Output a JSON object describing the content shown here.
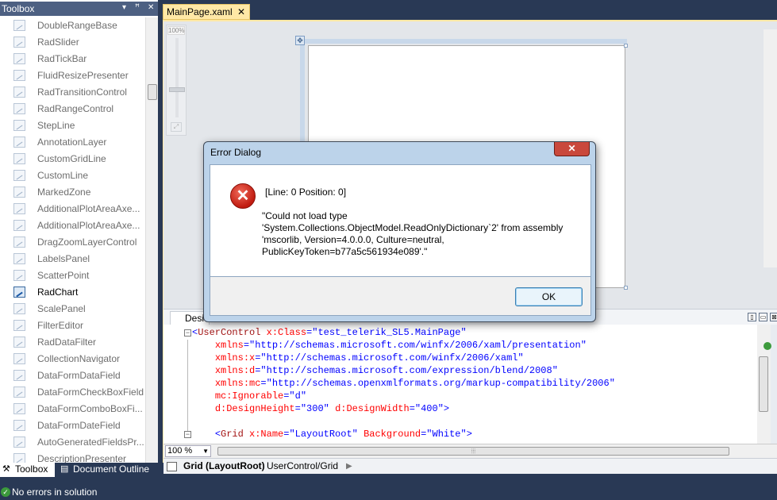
{
  "toolbox": {
    "title": "Toolbox",
    "pin_label": "▾",
    "pin_icon_label": "ꟸ",
    "close_label": "✕",
    "items": [
      {
        "label": "DoubleRangeBase"
      },
      {
        "label": "RadSlider"
      },
      {
        "label": "RadTickBar"
      },
      {
        "label": "FluidResizePresenter"
      },
      {
        "label": "RadTransitionControl"
      },
      {
        "label": "RadRangeControl"
      },
      {
        "label": "StepLine"
      },
      {
        "label": "AnnotationLayer"
      },
      {
        "label": "CustomGridLine"
      },
      {
        "label": "CustomLine"
      },
      {
        "label": "MarkedZone"
      },
      {
        "label": "AdditionalPlotAreaAxe..."
      },
      {
        "label": "AdditionalPlotAreaAxe..."
      },
      {
        "label": "DragZoomLayerControl"
      },
      {
        "label": "LabelsPanel"
      },
      {
        "label": "ScatterPoint"
      },
      {
        "label": "RadChart"
      },
      {
        "label": "ScalePanel"
      },
      {
        "label": "FilterEditor"
      },
      {
        "label": "RadDataFilter"
      },
      {
        "label": "CollectionNavigator"
      },
      {
        "label": "DataFormDataField"
      },
      {
        "label": "DataFormCheckBoxField"
      },
      {
        "label": "DataFormComboBoxFi..."
      },
      {
        "label": "DataFormDateField"
      },
      {
        "label": "AutoGeneratedFieldsPr..."
      },
      {
        "label": "DescriptionPresenter"
      }
    ]
  },
  "bottom_tabs": {
    "toolbox": "Toolbox",
    "document_outline": "Document Outline"
  },
  "status": {
    "text": "No errors in solution"
  },
  "document": {
    "tab_label": "MainPage.xaml",
    "tab_close": "✕"
  },
  "designer": {
    "zoom_slider_label": "100%",
    "design_tab_label": "Desi"
  },
  "editor": {
    "zoom_value": "100 %"
  },
  "breadcrumb": {
    "current": "Grid (LayoutRoot)",
    "path": "UserControl/Grid"
  },
  "dialog": {
    "title": "Error Dialog",
    "close_label": "✕",
    "line1": "[Line: 0 Position: 0]",
    "message_lines": [
      "\"Could not load type",
      "'System.Collections.ObjectModel.ReadOnlyDictionary`2' from assembly",
      "'mscorlib, Version=4.0.0.0, Culture=neutral,",
      "PublicKeyToken=b77a5c561934e089'.\""
    ],
    "ok_label": "OK"
  },
  "colors": {
    "chrome": "#293955",
    "tab_active": "#ffe8a6",
    "dialog_frame": "#bcd3ea",
    "error_red": "#c01b10"
  }
}
